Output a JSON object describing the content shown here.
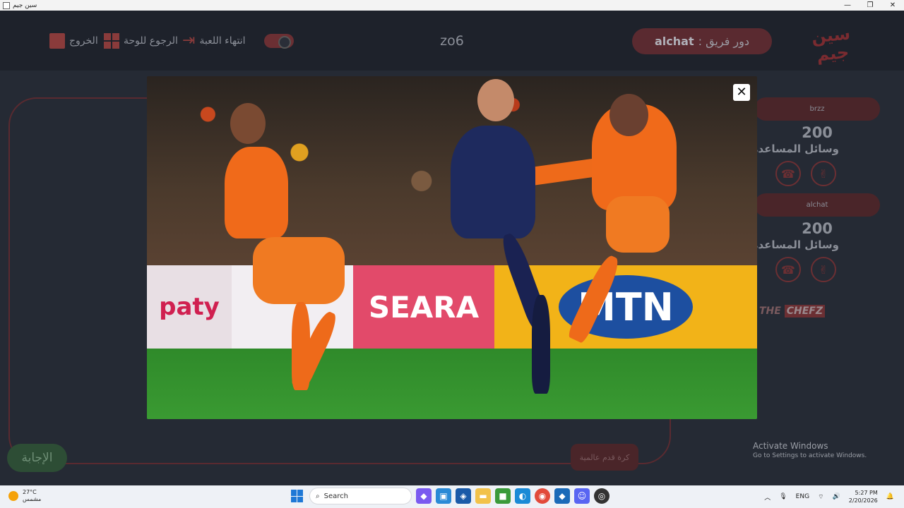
{
  "window": {
    "title": "سين جيم",
    "minimize": "—",
    "maximize": "❐",
    "close": "✕"
  },
  "header": {
    "exit_label": "الخروج",
    "back_to_board_label": "الرجوع للوحة",
    "end_game_label": "انتهاء اللعبة",
    "room_code": "zo6",
    "turn_prefix": "دور فريق :",
    "turn_team": "alchat",
    "logo_text": "سين جيم"
  },
  "teams": [
    {
      "name": "brzz",
      "score": "200",
      "aids_label": "وسائل المساعدة"
    },
    {
      "name": "alchat",
      "score": "200",
      "aids_label": "وسائل المساعدة"
    }
  ],
  "sponsor": {
    "prefix": "THE",
    "name": "CHEFZ"
  },
  "answer_button": "الإجابة",
  "category": "كرة قدم عالمية",
  "image_ads": {
    "ad1": "paty",
    "ad3": "SEARA",
    "ad4": "MTN"
  },
  "activation": {
    "line1": "Activate Windows",
    "line2": "Go to Settings to activate Windows."
  },
  "taskbar": {
    "weather_temp": "27°C",
    "weather_desc": "مشمس",
    "search_placeholder": "Search",
    "language": "ENG",
    "time": "5:27 PM",
    "date": "2/20/2026"
  },
  "colors": {
    "accent": "#6b2f33",
    "background": "#252a34",
    "answer_green": "#2d4d35"
  }
}
